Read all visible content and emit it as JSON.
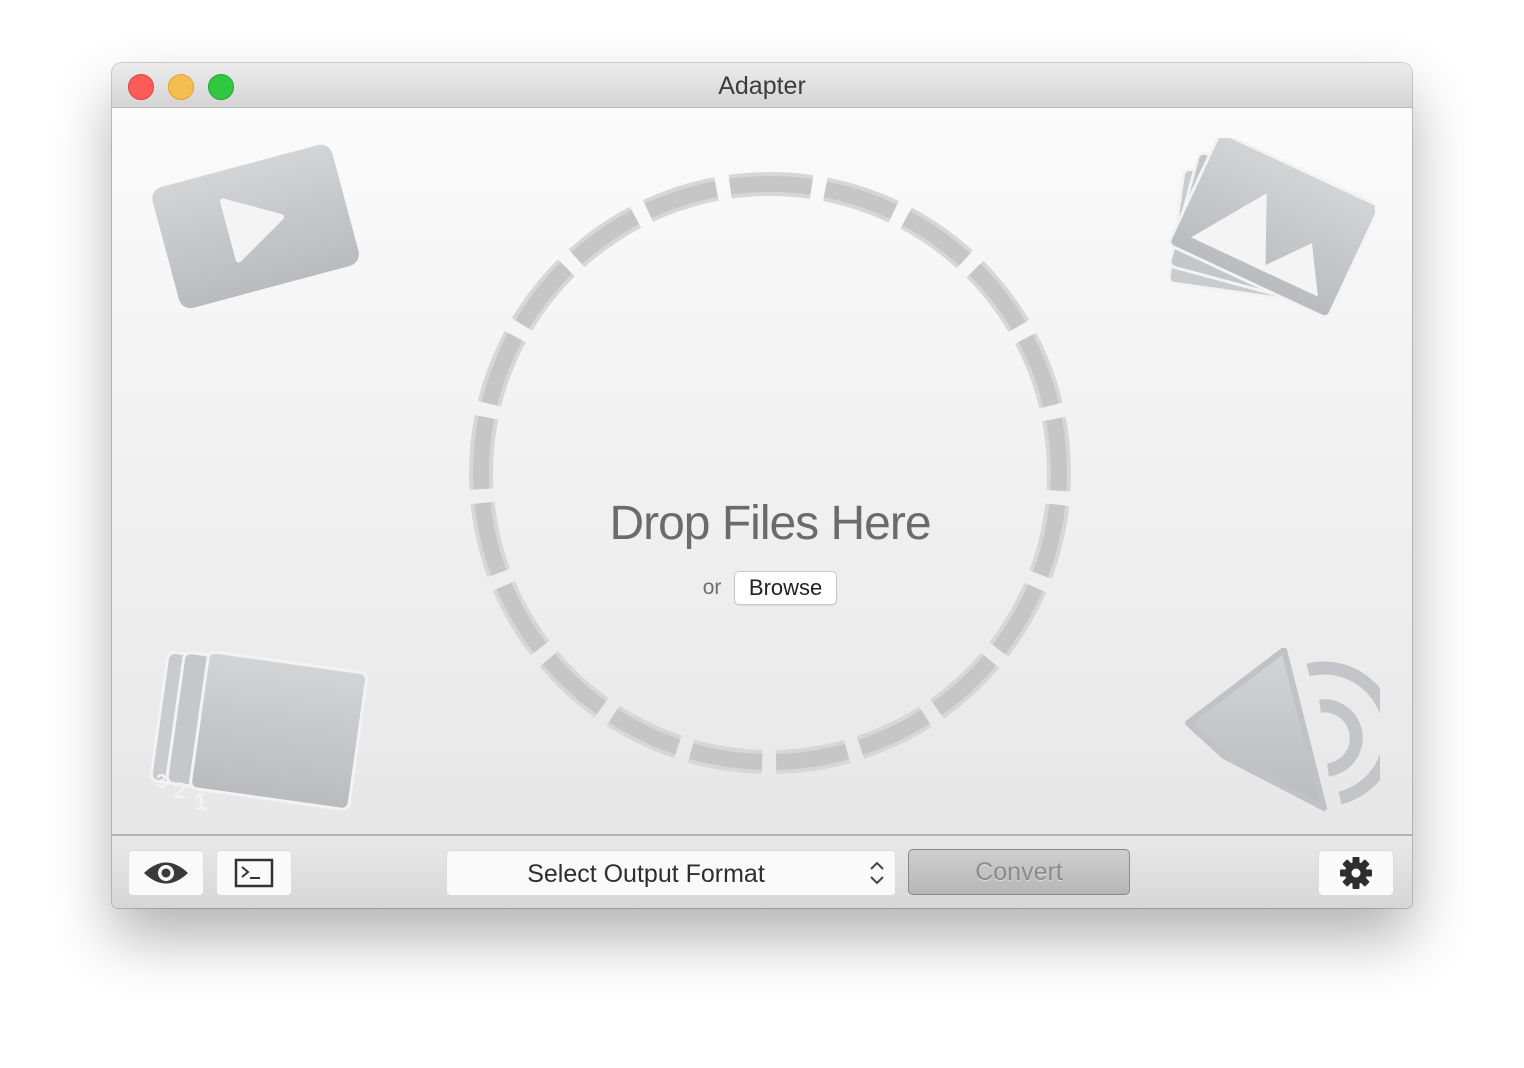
{
  "window": {
    "title": "Adapter",
    "traffic_lights": [
      "close",
      "minimize",
      "zoom"
    ]
  },
  "dropzone": {
    "headline": "Drop Files Here",
    "or_label": "or",
    "browse_label": "Browse"
  },
  "corner_icons": {
    "video": "video-play-icon",
    "images": "image-stack-icon",
    "sequence": "image-sequence-icon",
    "sequence_numbers": [
      "3",
      "2",
      "1"
    ],
    "audio": "speaker-icon"
  },
  "toolbar": {
    "preview_icon": "eye-icon",
    "log_icon": "terminal-icon",
    "output_format_placeholder": "Select Output Format",
    "convert_label": "Convert",
    "settings_icon": "gear-icon"
  },
  "colors": {
    "close": "#fc5b57",
    "minimize": "#f6be4f",
    "zoom": "#2fc840",
    "icon_gray": "#c4c6c9"
  }
}
